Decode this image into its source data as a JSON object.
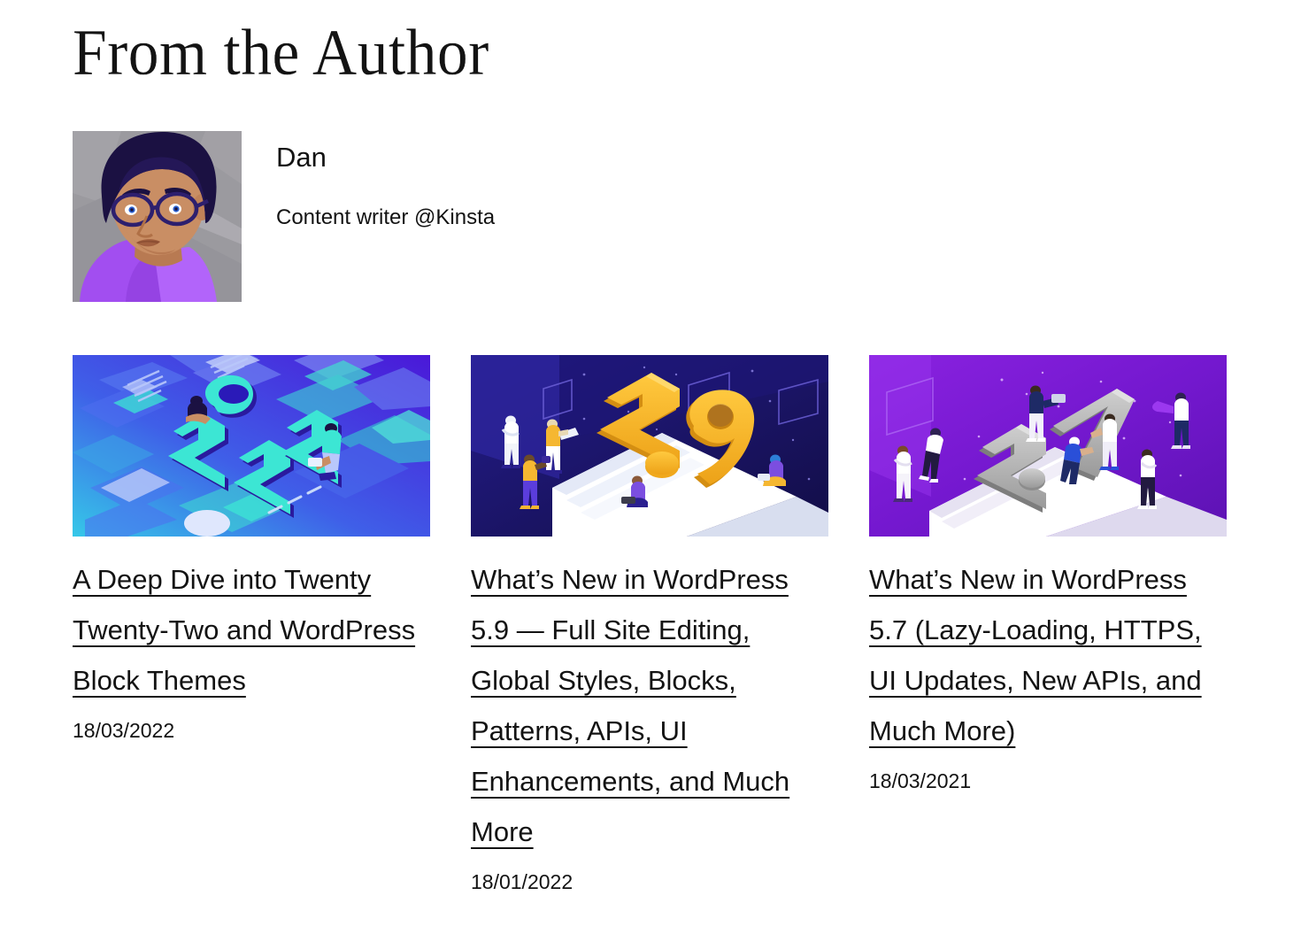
{
  "section": {
    "heading": "From the Author"
  },
  "author": {
    "avatar_icon": "author-avatar-illustration",
    "name": "Dan",
    "role": "Content writer @Kinsta"
  },
  "posts": [
    {
      "thumb_icon": "isometric-2022-illustration",
      "title": "A Deep Dive into Twenty Twenty-Two and WordPress Block Themes",
      "date": "18/03/2022"
    },
    {
      "thumb_icon": "isometric-wordpress-59-illustration",
      "title": "What’s New in WordPress 5.9 — Full Site Editing, Global Styles, Blocks, Patterns, APIs, UI Enhancements, and Much More",
      "date": "18/01/2022"
    },
    {
      "thumb_icon": "isometric-wordpress-57-illustration",
      "title": "What’s New in WordPress 5.7 (Lazy-Loading, HTTPS, UI Updates, New APIs, and Much More)",
      "date": "18/03/2021"
    }
  ],
  "colors": {
    "page_background": "#ffffff",
    "text": "#131313",
    "avatar_background": "#9b9a9f",
    "avatar_hair": "#1b1142",
    "avatar_skin": "#c98e64",
    "avatar_shirt": "#a24ef0",
    "card1_blue": "#3f5fe8",
    "card1_teal": "#3ce6d4",
    "card1_purple": "#4a25d8",
    "card2_navy": "#1a1464",
    "card2_gold": "#f5b731",
    "card3_purple": "#7b1fd4",
    "card3_gray": "#9a9a9a"
  }
}
